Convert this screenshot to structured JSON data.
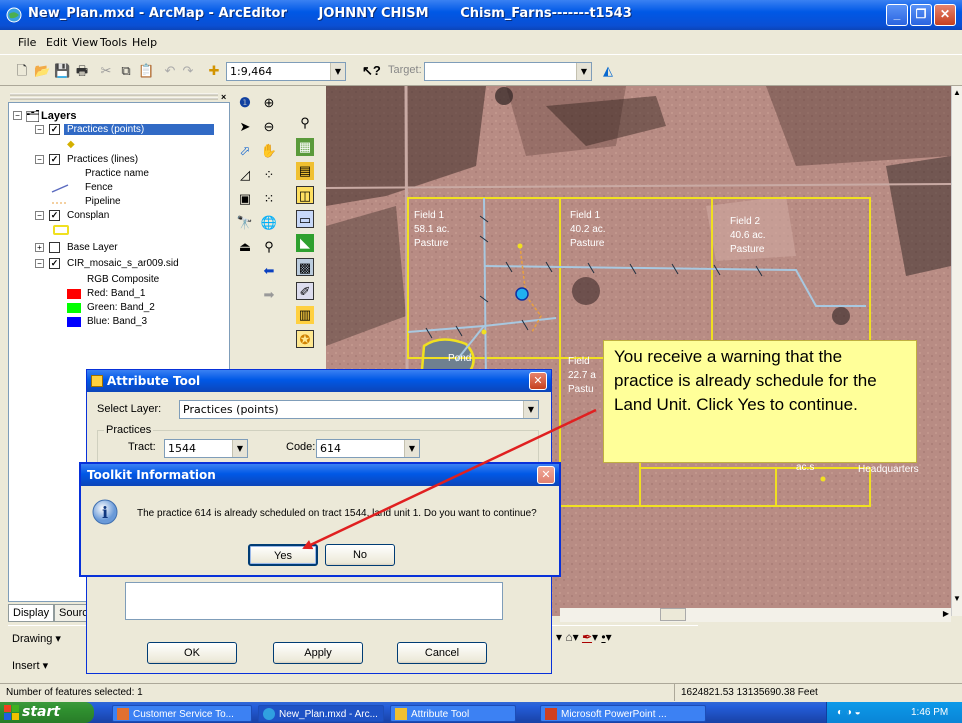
{
  "window": {
    "title": "New_Plan.mxd - ArcMap - ArcEditor       JOHNNY CHISM       Chism_Farns-------t1543",
    "controls": [
      "_",
      "❐",
      "✕"
    ]
  },
  "menu": [
    "File",
    "Edit",
    "View",
    "Tools",
    "Help"
  ],
  "toolbar": {
    "scale": "1:9,464",
    "target_label": "Target:",
    "target_value": ""
  },
  "toc": {
    "root": "Layers",
    "items": [
      {
        "label": "Practices (points)",
        "checked": true,
        "selected": true
      },
      {
        "label": "Practices (lines)",
        "checked": true
      },
      {
        "label": "Practice name"
      },
      {
        "label": "Fence"
      },
      {
        "label": "Pipeline"
      },
      {
        "label": "Consplan",
        "checked": true
      },
      {
        "label": "Base Layer",
        "checked": false
      },
      {
        "label": "CIR_mosaic_s_ar009.sid",
        "checked": true
      },
      {
        "label": "RGB Composite"
      },
      {
        "label": "Red:   Band_1",
        "color": "#ff0000"
      },
      {
        "label": "Green: Band_2",
        "color": "#00ff00"
      },
      {
        "label": "Blue:  Band_3",
        "color": "#0000ff"
      }
    ],
    "tabs": [
      "Display",
      "Sourc"
    ]
  },
  "map": {
    "fields": [
      {
        "line1": "Field  1",
        "line2": "58.1 ac.",
        "line3": "Pasture"
      },
      {
        "line1": "Field  1",
        "line2": "40.2 ac.",
        "line3": "Pasture"
      },
      {
        "line1": "Field  2",
        "line2": "40.6 ac.",
        "line3": "Pasture"
      },
      {
        "line1": "Field",
        "line2": "22.7 a",
        "line3": "Pastu"
      }
    ],
    "pond": "Pond",
    "headquarters": "Headquarters",
    "partial_label": "ac.s"
  },
  "callout": {
    "text": "You receive a warning that the practice is already schedule for the Land Unit. Click Yes to continue."
  },
  "attribute_tool": {
    "title": "Attribute Tool",
    "select_layer_label": "Select Layer:",
    "select_layer_value": "Practices (points)",
    "practices_group": "Practices",
    "tract_label": "Tract:",
    "tract_value": "1544",
    "code_label": "Code:",
    "code_value": "614",
    "ok": "OK",
    "apply": "Apply",
    "cancel": "Cancel"
  },
  "toolkit_info": {
    "title": "Toolkit Information",
    "message": "The practice 614 is already scheduled on tract 1544, land unit 1.  Do you want to continue?",
    "yes": "Yes",
    "no": "No"
  },
  "bottom_bars": {
    "drawing": "Drawing",
    "insert": "Insert"
  },
  "status": {
    "features": "Number of features selected: 1",
    "coords": "1624821.53  13135690.38 Feet"
  },
  "taskbar": {
    "start": "start",
    "tasks": [
      "Customer Service To...",
      "New_Plan.mxd - Arc...",
      "Attribute Tool",
      "Microsoft PowerPoint ..."
    ],
    "clock": "1:46 PM"
  },
  "colors": {
    "xp_blue": "#0058e6",
    "field_boundary": "#f0e020",
    "callout_bg": "#ffff99",
    "arrow": "#e02020"
  }
}
